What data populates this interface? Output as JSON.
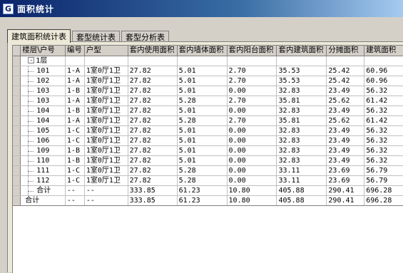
{
  "window": {
    "title": "面积统计",
    "icon": "app-icon"
  },
  "tabs": [
    {
      "label": "建筑面积统计表",
      "active": true
    },
    {
      "label": "套型统计表",
      "active": false
    },
    {
      "label": "套型分析表",
      "active": false
    }
  ],
  "table": {
    "columns": [
      "楼层\\户号",
      "编号",
      "户型",
      "套内使用面积",
      "套内墙体面积",
      "套内阳台面积",
      "套内建筑面积",
      "分摊面积",
      "建筑面积"
    ],
    "group_label": "1层",
    "group_toggle": "-",
    "rows": [
      [
        "101",
        "1-A",
        "1室0厅1卫",
        "27.82",
        "5.01",
        "2.70",
        "35.53",
        "25.42",
        "60.96"
      ],
      [
        "102",
        "1-A",
        "1室0厅1卫",
        "27.82",
        "5.01",
        "2.70",
        "35.53",
        "25.42",
        "60.96"
      ],
      [
        "103",
        "1-B",
        "1室0厅1卫",
        "27.82",
        "5.01",
        "0.00",
        "32.83",
        "23.49",
        "56.32"
      ],
      [
        "103",
        "1-A",
        "1室0厅1卫",
        "27.82",
        "5.28",
        "2.70",
        "35.81",
        "25.62",
        "61.42"
      ],
      [
        "104",
        "1-B",
        "1室0厅1卫",
        "27.82",
        "5.01",
        "0.00",
        "32.83",
        "23.49",
        "56.32"
      ],
      [
        "104",
        "1-A",
        "1室0厅1卫",
        "27.82",
        "5.28",
        "2.70",
        "35.81",
        "25.62",
        "61.42"
      ],
      [
        "105",
        "1-C",
        "1室0厅1卫",
        "27.82",
        "5.01",
        "0.00",
        "32.83",
        "23.49",
        "56.32"
      ],
      [
        "106",
        "1-C",
        "1室0厅1卫",
        "27.82",
        "5.01",
        "0.00",
        "32.83",
        "23.49",
        "56.32"
      ],
      [
        "109",
        "1-B",
        "1室0厅1卫",
        "27.82",
        "5.01",
        "0.00",
        "32.83",
        "23.49",
        "56.32"
      ],
      [
        "110",
        "1-B",
        "1室0厅1卫",
        "27.82",
        "5.01",
        "0.00",
        "32.83",
        "23.49",
        "56.32"
      ],
      [
        "111",
        "1-C",
        "1室0厅1卫",
        "27.82",
        "5.28",
        "0.00",
        "33.11",
        "23.69",
        "56.79"
      ],
      [
        "112",
        "1-C",
        "1室0厅1卫",
        "27.82",
        "5.28",
        "0.00",
        "33.11",
        "23.69",
        "56.79"
      ]
    ],
    "subtotal": [
      "合计",
      "--",
      "--",
      "333.85",
      "61.23",
      "10.80",
      "405.88",
      "290.41",
      "696.28"
    ],
    "total": [
      "合计",
      "--",
      "--",
      "333.85",
      "61.23",
      "10.80",
      "405.88",
      "290.41",
      "696.28"
    ]
  }
}
